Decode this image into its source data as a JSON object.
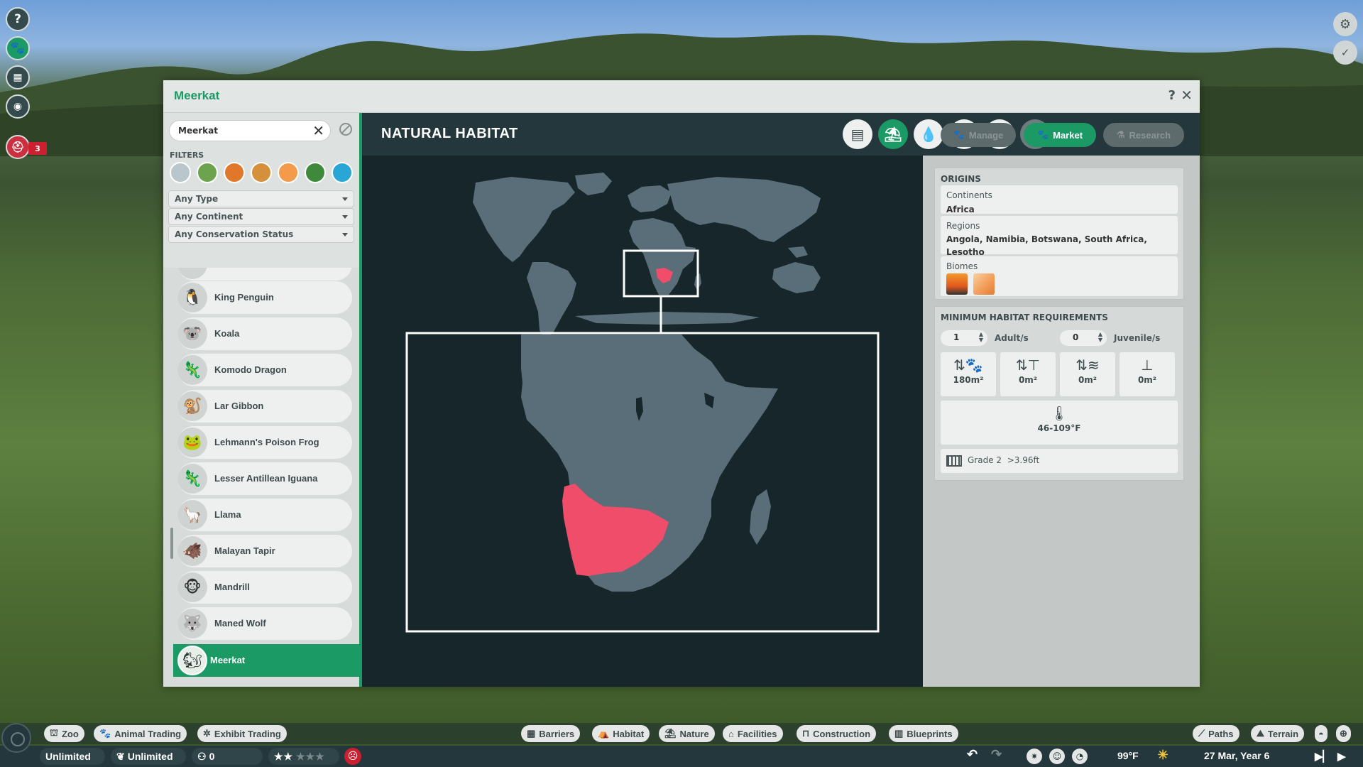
{
  "window": {
    "title": "Meerkat",
    "help_icon": "?",
    "close_icon": "✕"
  },
  "search": {
    "value": "Meerkat",
    "clear_icon": "✕"
  },
  "filters": {
    "label": "FILTERS",
    "biome_colors": [
      "#b9c7cd",
      "#6da24e",
      "#e0772a",
      "#d4903a",
      "#f39a4b",
      "#3f8a3a",
      "#29a6d6"
    ],
    "dropdowns": [
      "Any Type",
      "Any Continent",
      "Any Conservation Status"
    ]
  },
  "animal_list": [
    {
      "name": "King Penguin",
      "icon": "🐧"
    },
    {
      "name": "Koala",
      "icon": "🐨"
    },
    {
      "name": "Komodo Dragon",
      "icon": "🦎"
    },
    {
      "name": "Lar Gibbon",
      "icon": "🐒"
    },
    {
      "name": "Lehmann's Poison Frog",
      "icon": "🐸"
    },
    {
      "name": "Lesser Antillean Iguana",
      "icon": "🦎"
    },
    {
      "name": "Llama",
      "icon": "🦙"
    },
    {
      "name": "Malayan Tapir",
      "icon": "🐗"
    },
    {
      "name": "Mandrill",
      "icon": "🐵"
    },
    {
      "name": "Maned Wolf",
      "icon": "🐺"
    },
    {
      "name": "Meerkat",
      "icon": "🐿",
      "selected": true
    }
  ],
  "header": {
    "title": "NATURAL HABITAT",
    "tabs": [
      {
        "icon": "clipboard-icon",
        "glyph": "▤"
      },
      {
        "icon": "habitat-icon",
        "glyph": "⛱",
        "active": true
      },
      {
        "icon": "water-drop-icon",
        "glyph": "💧"
      },
      {
        "icon": "enrichment-icon",
        "glyph": "⚗"
      },
      {
        "icon": "paw-icon",
        "glyph": "🐾"
      },
      {
        "icon": "trophy-icon",
        "glyph": "🏆",
        "disabled": true
      }
    ],
    "buttons": {
      "manage": "Manage",
      "market": "Market",
      "research": "Research"
    }
  },
  "map": {
    "highlight_color": "#f04d6a",
    "land_color": "#5a6e7a"
  },
  "origins": {
    "title": "ORIGINS",
    "continents_label": "Continents",
    "continents_value": "Africa",
    "regions_label": "Regions",
    "regions_value": "Angola, Namibia, Botswana, South Africa, Lesotho",
    "biomes_label": "Biomes"
  },
  "requirements": {
    "title": "MINIMUM HABITAT REQUIREMENTS",
    "adults_value": "1",
    "adults_label": "Adult/s",
    "juveniles_value": "0",
    "juveniles_label": "Juvenile/s",
    "land_area": "180m²",
    "climbing_area": "0m²",
    "water_area": "0m²",
    "deep_water_area": "0m²",
    "temperature": "46-109°F",
    "grade": "Grade 2",
    "height": ">3.96ft"
  },
  "bottom_bar": {
    "top_buttons": [
      "Zoo",
      "Animal Trading",
      "Exhibit Trading",
      "Barriers",
      "Habitat",
      "Nature",
      "Facilities",
      "Construction",
      "Blueprints",
      "Paths",
      "Terrain"
    ],
    "money": "Unlimited",
    "research": "Unlimited",
    "guests": "0",
    "temperature": "99°F",
    "date": "27 Mar, Year 6"
  },
  "side": {
    "notification_count": "3"
  }
}
